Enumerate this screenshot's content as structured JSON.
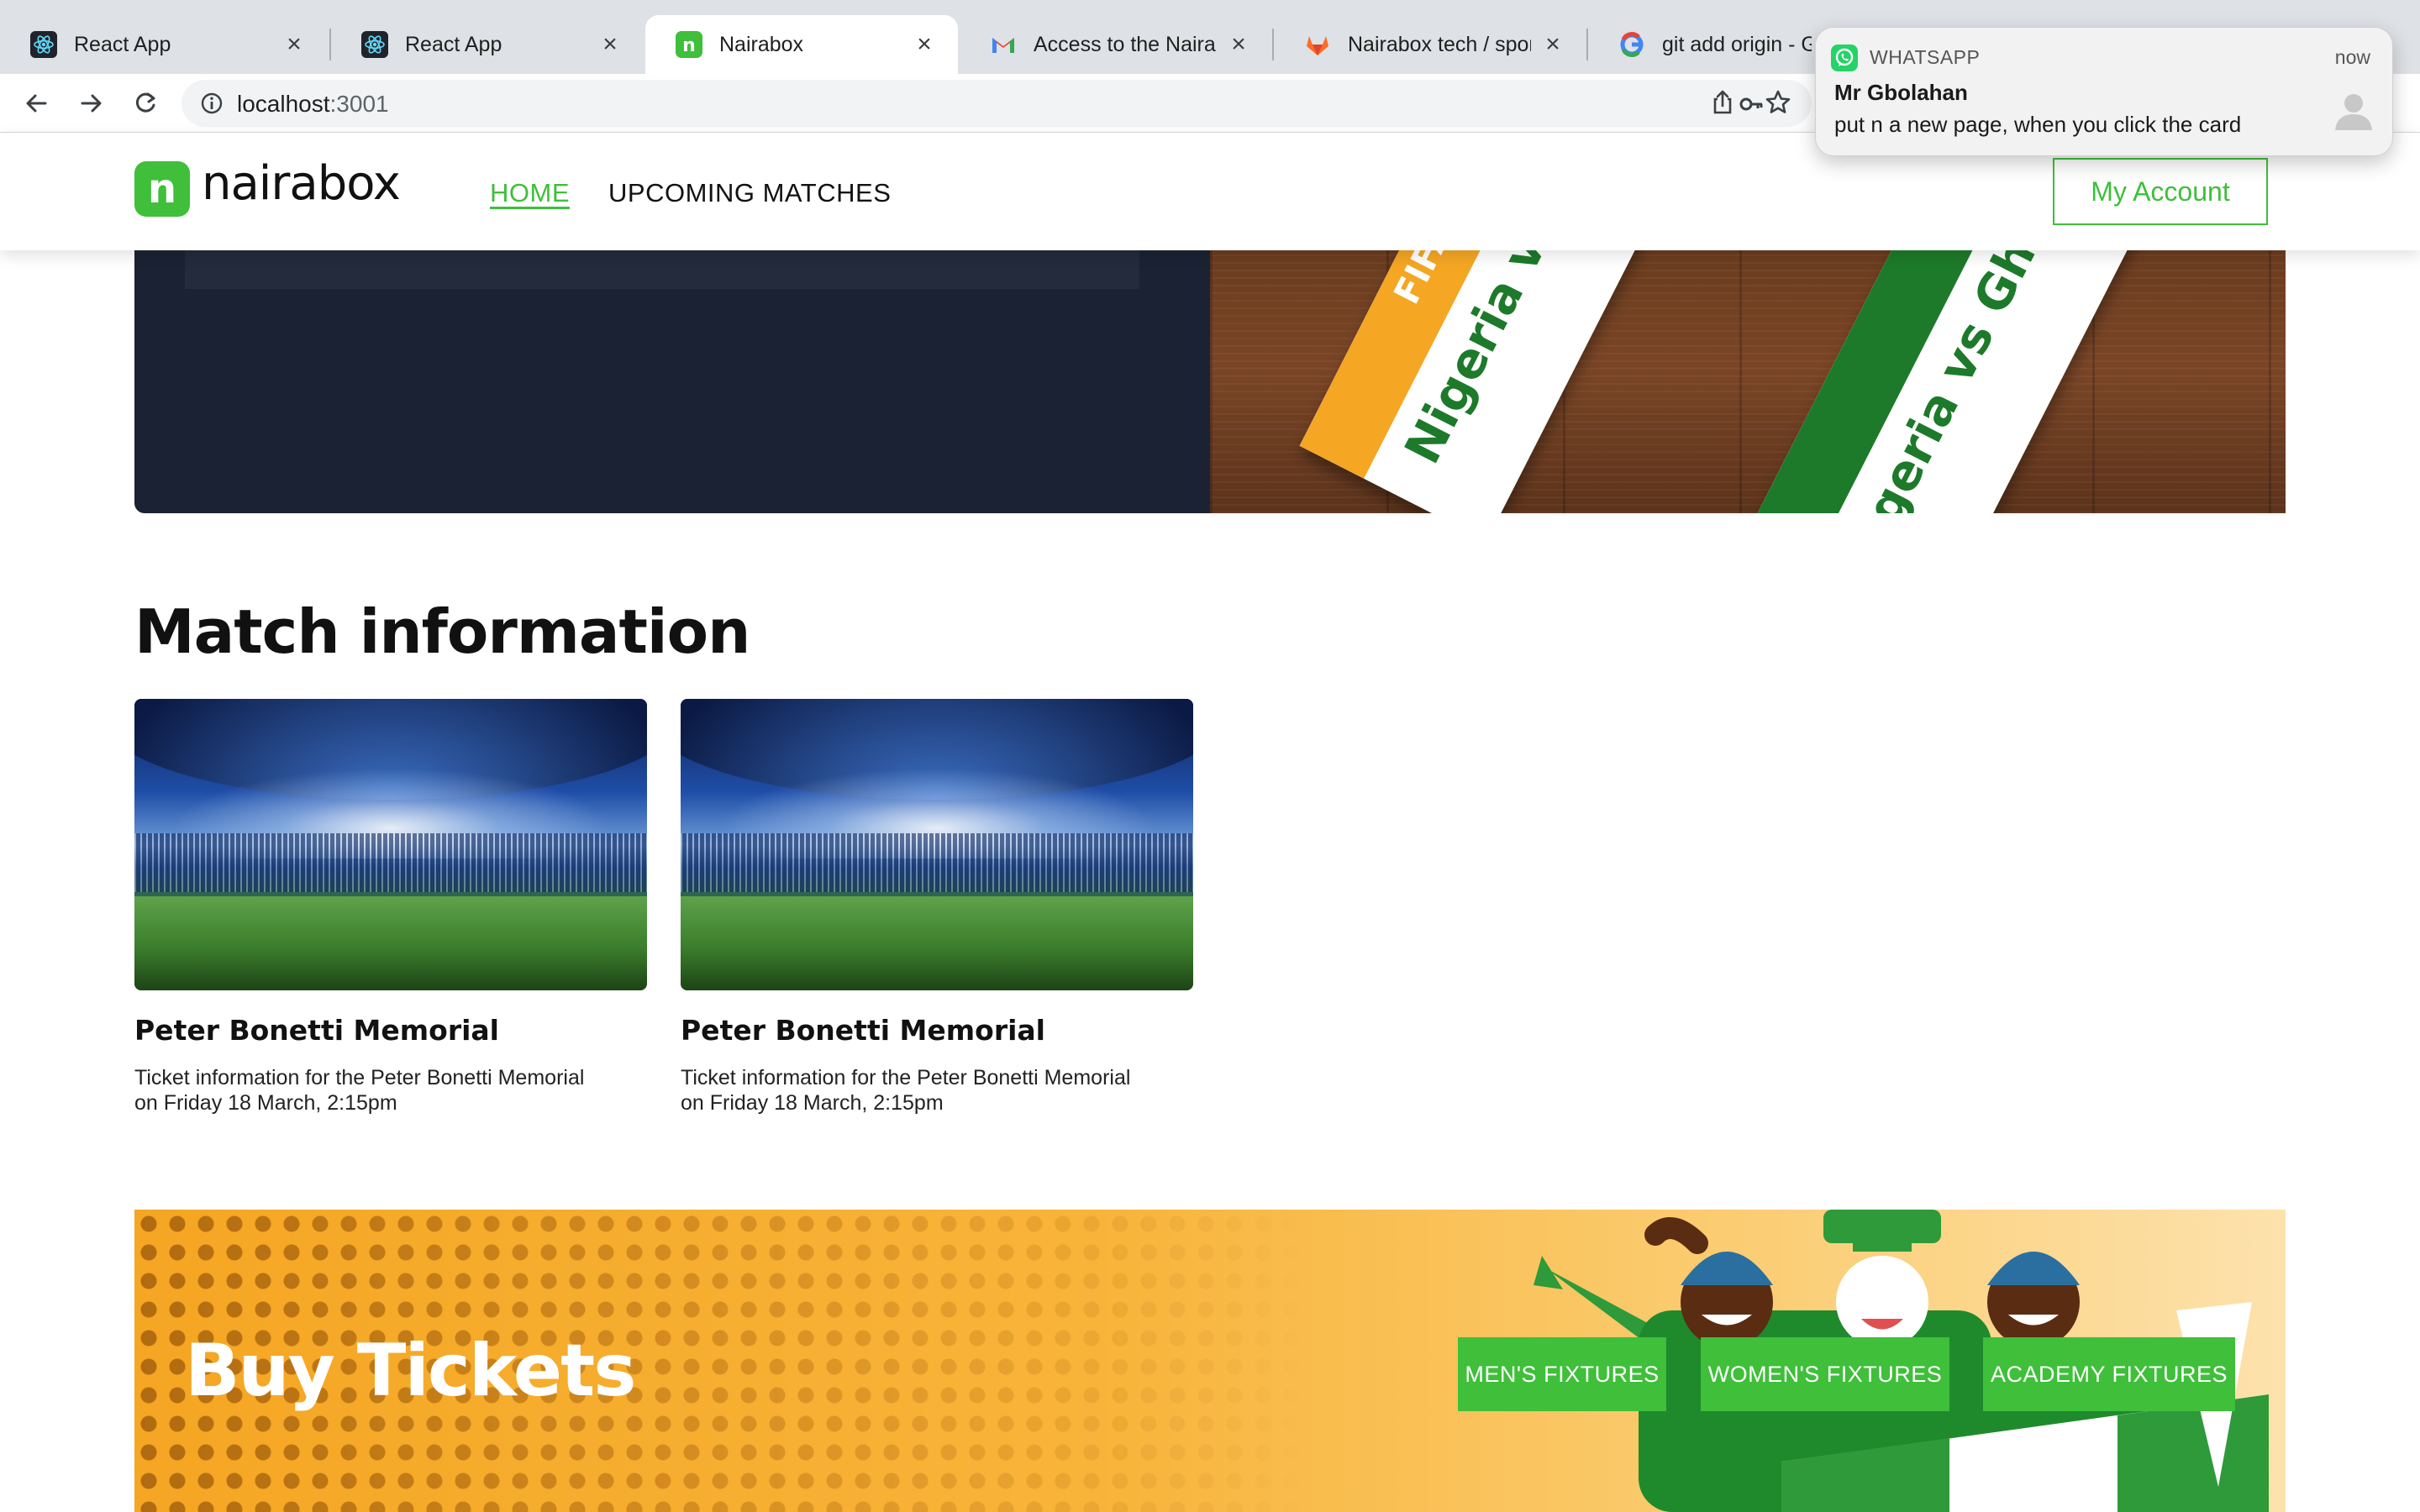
{
  "browser": {
    "tabs": [
      {
        "title": "React App",
        "icon": "react-icon",
        "active": false
      },
      {
        "title": "React App",
        "icon": "react-icon",
        "active": false
      },
      {
        "title": "Nairabox",
        "icon": "nairabox-icon",
        "active": true
      },
      {
        "title": "Access to the Nairabo",
        "icon": "gmail-icon",
        "active": false
      },
      {
        "title": "Nairabox tech / sports",
        "icon": "gitlab-icon",
        "active": false
      },
      {
        "title": "git add origin - Go",
        "icon": "google-icon",
        "active": false
      }
    ],
    "url_host": "localhost",
    "url_port": ":3001"
  },
  "header": {
    "logo_letter": "n",
    "logo_text": "nairabox",
    "nav": [
      {
        "label": "HOME",
        "active": true
      },
      {
        "label": "UPCOMING MATCHES",
        "active": false
      }
    ],
    "account_button": "My Account"
  },
  "hero": {
    "ticket_title_1": "Nigeria vs Gha",
    "ticket_title_2": "igeria vs Ghana",
    "ticket_badge": "FIFA"
  },
  "match_info": {
    "title": "Match information",
    "cards": [
      {
        "title": "Peter Bonetti Memorial",
        "description": "Ticket information for the Peter Bonetti Memorial on Friday 18 March, 2:15pm"
      },
      {
        "title": "Peter Bonetti Memorial",
        "description": "Ticket information for the Peter Bonetti Memorial on Friday 18 March, 2:15pm"
      }
    ]
  },
  "banner": {
    "title": "Buy Tickets",
    "buttons": [
      "MEN'S FIXTURES",
      "WOMEN'S FIXTURES",
      "ACADEMY FIXTURES"
    ]
  },
  "notification": {
    "app": "WHATSAPP",
    "time": "now",
    "sender": "Mr Gbolahan",
    "message": "put n a new page, when you click the card"
  },
  "colors": {
    "brand_green": "#3fbf3a",
    "hero_dark": "#1b2233",
    "banner_orange": "#f5a623"
  }
}
